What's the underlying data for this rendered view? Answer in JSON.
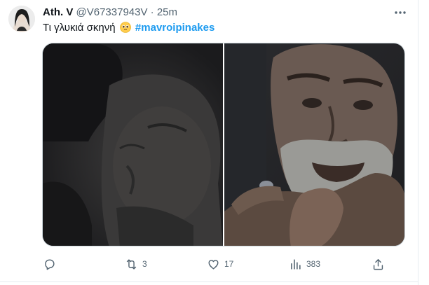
{
  "tweet": {
    "author_name": "Ath. V",
    "handle": "@V67337943V",
    "separator": "·",
    "time": "25m",
    "text": "Τι γλυκιά σκηνή",
    "emoji": "pleading-face",
    "hashtag": "#mavroipinakes"
  },
  "actions": {
    "reply_count": "",
    "retweet_count": "3",
    "like_count": "17",
    "views_count": "383"
  },
  "colors": {
    "hashtag": "#1d9bf0",
    "muted": "#536471",
    "text": "#0f1419"
  }
}
